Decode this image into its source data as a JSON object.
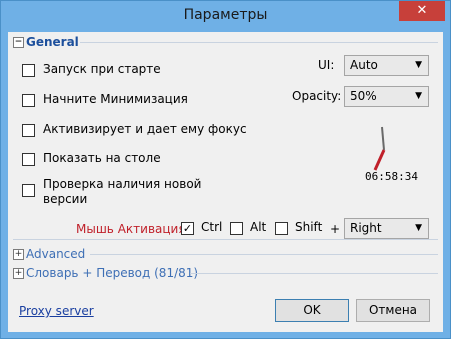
{
  "window": {
    "title": "Параметры",
    "close_glyph": "✕"
  },
  "general": {
    "header": "General",
    "toggle": "−",
    "checkboxes": [
      {
        "label": "Запуск при старте",
        "checked": false
      },
      {
        "label": "Начните Минимизация",
        "checked": false
      },
      {
        "label": "Активизирует и дает ему фокус",
        "checked": false
      },
      {
        "label": "Показать на столе",
        "checked": false
      },
      {
        "label_line1": "Проверка наличия новой",
        "label_line2": "версии",
        "checked": false
      }
    ],
    "ui": {
      "label": "UI:",
      "value": "Auto"
    },
    "opacity": {
      "label": "Opacity:",
      "value": "50%"
    },
    "clock_time": "06:58:34",
    "activation": {
      "label": "Мышь Активация:",
      "ctrl": {
        "label": "Ctrl",
        "checked": true,
        "mark": "✓"
      },
      "alt": {
        "label": "Alt",
        "checked": false
      },
      "shift": {
        "label": "Shift",
        "checked": false
      },
      "plus": "+",
      "button_value": "Right"
    }
  },
  "sections": {
    "advanced": {
      "toggle": "+",
      "label": "Advanced"
    },
    "dictionary": {
      "toggle": "+",
      "label": "Словарь + Перевод (81/81)"
    }
  },
  "footer": {
    "proxy_link": "Proxy server",
    "ok": "OK",
    "cancel": "Отмена"
  },
  "colors": {
    "frame": "#6fb0e6",
    "close": "#c7403a",
    "activation_label": "#c0202a",
    "link": "#1a3fa0"
  }
}
